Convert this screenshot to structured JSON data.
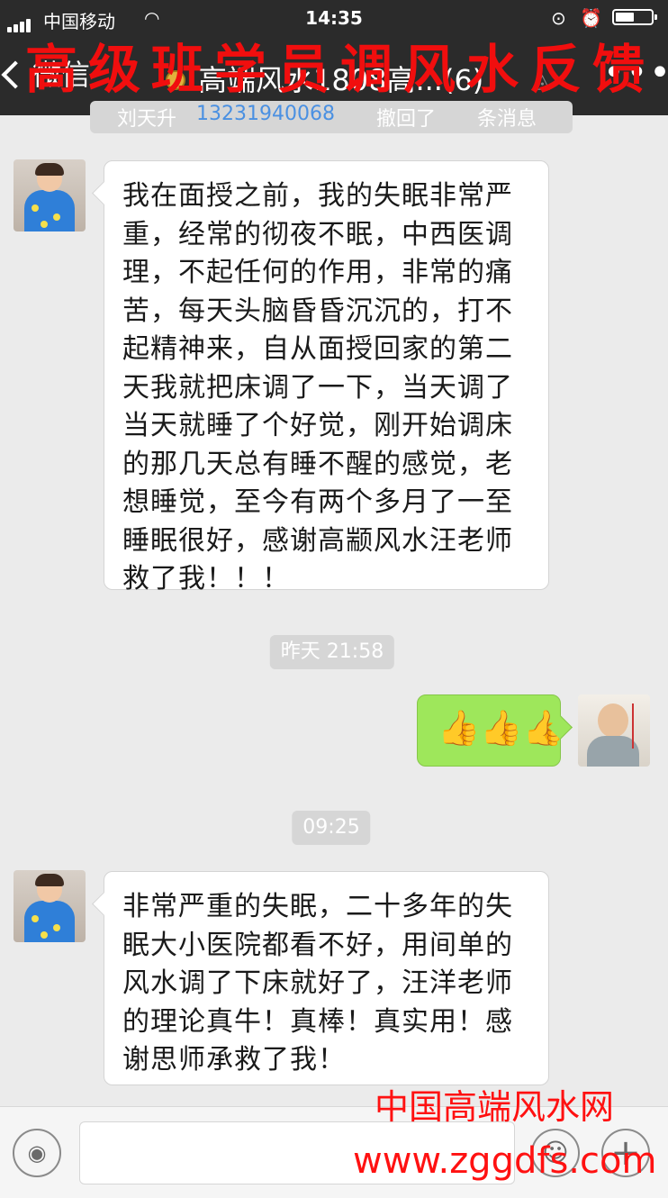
{
  "status_bar": {
    "carrier": "中国移动",
    "time": "14:35",
    "wifi_icon": "wifi-icon",
    "lock_icon": "rotation-lock-icon",
    "alarm_icon": "alarm-icon",
    "battery_icon": "battery-icon"
  },
  "nav": {
    "back_label": "微信",
    "title": "高端风水1808高...(6)",
    "mute_icon": "mute-icon",
    "more_label": "•••"
  },
  "overlay_title": "高级班学员调风水反馈",
  "recall_notice": {
    "name": "刘天升",
    "phone": "13231940068",
    "action": "撤回了",
    "who": "条消息"
  },
  "messages": [
    {
      "sender": "other",
      "text": "我在面授之前，我的失眠非常严重，经常的彻夜不眠，中西医调理，不起任何的作用，非常的痛苦，每天头脑昏昏沉沉的，打不起精神来，自从面授回家的第二天我就把床调了一下，当天调了当天就睡了个好觉，刚开始调床的那几天总有睡不醒的感觉，老想睡觉，至今有两个多月了一至睡眠很好，感谢高颛风水汪老师救了我！！！"
    },
    {
      "timestamp": "昨天 21:58"
    },
    {
      "sender": "me",
      "text": "👍👍👍"
    },
    {
      "timestamp": "09:25"
    },
    {
      "sender": "other",
      "text": "非常严重的失眠，二十多年的失眠大小医院都看不好，用间单的风水调了下床就好了，汪洋老师的理论真牛！真棒！真实用！感谢思师承救了我！"
    }
  ],
  "input_bar": {
    "voice_icon": "voice-icon",
    "emoji_icon": "emoji-icon",
    "plus_icon": "plus-icon"
  },
  "watermark": {
    "line1": "中国高端风水网",
    "line2": "www.zggdfs.com"
  },
  "colors": {
    "header_bg": "#2b2b2b",
    "chat_bg": "#ebebeb",
    "my_bubble": "#9ee75b",
    "watermark": "#ff1111"
  }
}
